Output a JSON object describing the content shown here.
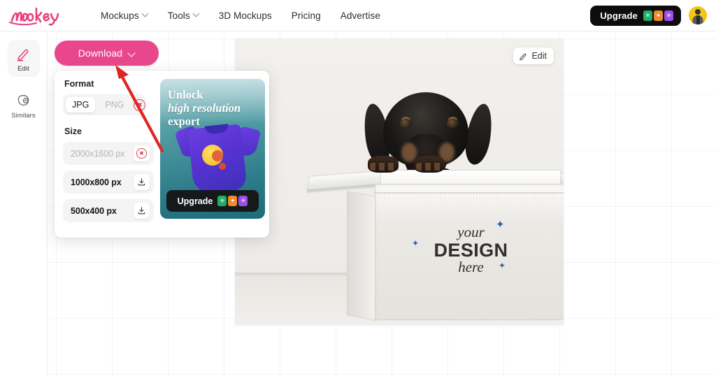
{
  "header": {
    "logo_text": "mockey",
    "nav": [
      {
        "label": "Mockups",
        "has_chevron": true
      },
      {
        "label": "Tools",
        "has_chevron": true
      },
      {
        "label": "3D Mockups",
        "has_chevron": false
      },
      {
        "label": "Pricing",
        "has_chevron": false
      },
      {
        "label": "Advertise",
        "has_chevron": false
      }
    ],
    "upgrade_label": "Upgrade",
    "upgrade_icon_colors": [
      "#1fae6a",
      "#f08a2c",
      "#9b4dea"
    ],
    "avatar_name": "user-avatar"
  },
  "sidebar": {
    "items": [
      {
        "label": "Edit",
        "icon": "pencil-icon",
        "active": true
      },
      {
        "label": "Similars",
        "icon": "similars-icon",
        "active": false
      }
    ]
  },
  "download": {
    "button_label": "Download",
    "button_color": "#e8478e",
    "format": {
      "title": "Format",
      "options": [
        {
          "label": "JPG",
          "selected": true,
          "locked": false
        },
        {
          "label": "PNG",
          "selected": false,
          "locked": true
        }
      ]
    },
    "size": {
      "title": "Size",
      "options": [
        {
          "label": "2000x1600 px",
          "locked": true
        },
        {
          "label": "1000x800 px",
          "locked": false
        },
        {
          "label": "500x400 px",
          "locked": false
        }
      ]
    },
    "promo": {
      "line1": "Unlock",
      "line2": "high resolution",
      "line3": "export",
      "cta_label": "Upgrade",
      "cta_icon_colors": [
        "#1fae6a",
        "#f08a2c",
        "#9b4dea"
      ]
    }
  },
  "canvas": {
    "edit_button_label": "Edit",
    "mockup_design": {
      "line1": "your",
      "line2": "DESIGN",
      "line3": "here",
      "sparkle_color": "#2b5fb5"
    },
    "annotation": {
      "type": "red-arrow",
      "color": "#e02424",
      "points_to": "download-button"
    }
  }
}
